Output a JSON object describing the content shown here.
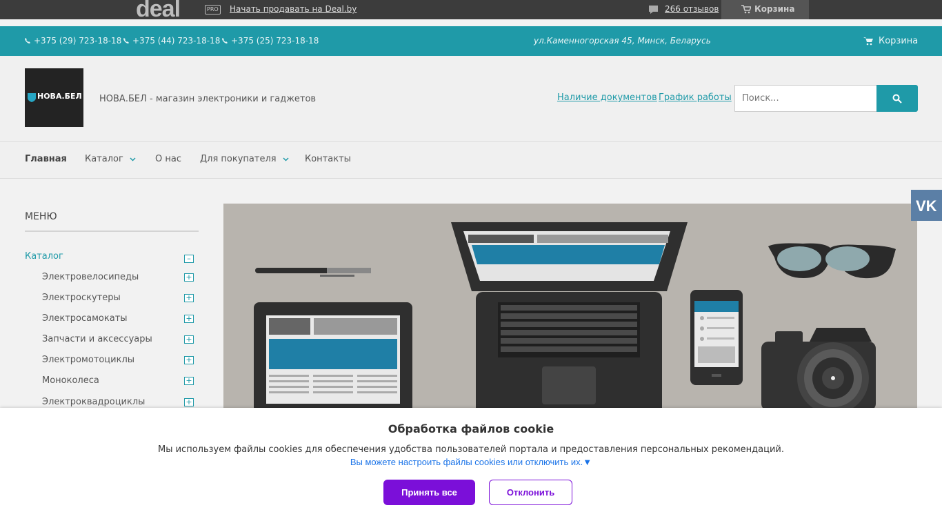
{
  "dealbar": {
    "logo": "deal",
    "pro_badge": "PRO",
    "sell_link": "Начать продавать на Deal.by",
    "reviews": "266 отзывов",
    "cart": "Корзина"
  },
  "contact": {
    "phones": [
      "+375 (29) 723-18-18",
      "+375 (44) 723-18-18",
      "+375 (25) 723-18-18"
    ],
    "address": "ул.Каменногорская 45, Минск, Беларусь",
    "cart": "Корзина"
  },
  "header": {
    "logo_text": "НОВА.БЕЛ",
    "tagline": "НОВА.БЕЛ - магазин электроники и гаджетов",
    "docs_link": "Наличие документов",
    "schedule_link": "График работы",
    "search_placeholder": "Поиск..."
  },
  "nav": {
    "items": [
      "Главная",
      "Каталог",
      "О нас",
      "Для покупателя",
      "Контакты"
    ]
  },
  "sidebar": {
    "title": "МЕНЮ",
    "catalog": "Каталог",
    "catalog_toggle": "–",
    "items": [
      {
        "label": "Электровелосипеды",
        "toggle": "+"
      },
      {
        "label": "Электроскутеры",
        "toggle": "+"
      },
      {
        "label": "Электросамокаты",
        "toggle": "+"
      },
      {
        "label": "Запчасти и аксессуары",
        "toggle": "+"
      },
      {
        "label": "Электромотоциклы",
        "toggle": "+"
      },
      {
        "label": "Моноколеса",
        "toggle": "+"
      },
      {
        "label": "Электроквадроциклы",
        "toggle": "+"
      }
    ]
  },
  "social": {
    "vk": "VK"
  },
  "cookie": {
    "title": "Обработка файлов cookie",
    "text": "Мы используем файлы cookies для обеспечения удобства пользователей портала и предоставления персональных рекомендаций.",
    "settings_link": "Вы можете настроить файлы cookies или отключить их.▼",
    "accept": "Принять все",
    "reject": "Отклонить"
  },
  "colors": {
    "accent": "#1f9aa8",
    "cookie_button": "#7b0fd9",
    "dealbar": "#3c3c3c"
  }
}
